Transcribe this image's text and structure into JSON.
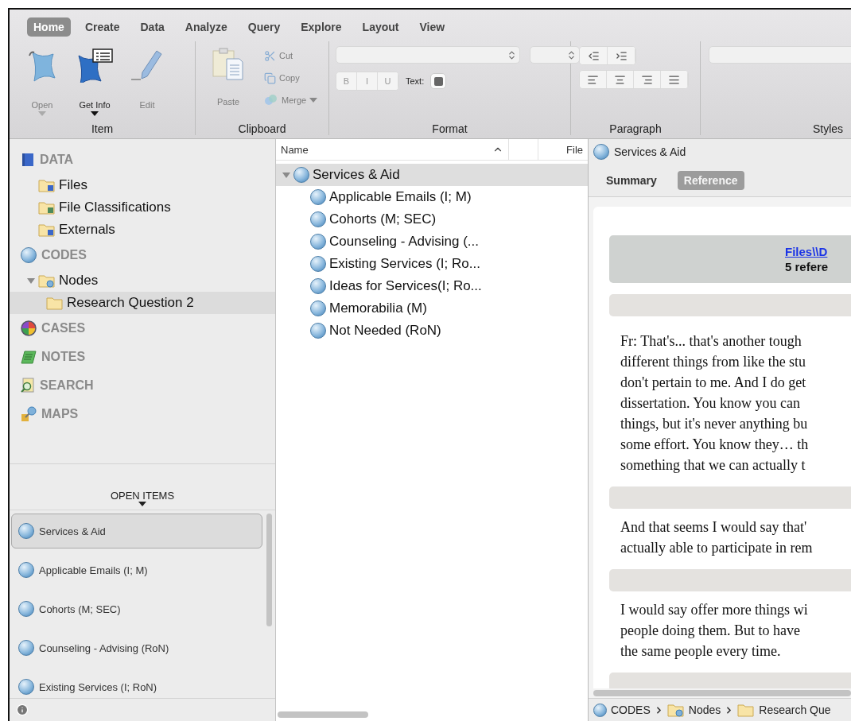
{
  "ribbon": {
    "tabs": [
      {
        "label": "Home",
        "selected": true
      },
      {
        "label": "Create",
        "selected": false
      },
      {
        "label": "Data",
        "selected": false
      },
      {
        "label": "Analyze",
        "selected": false
      },
      {
        "label": "Query",
        "selected": false
      },
      {
        "label": "Explore",
        "selected": false
      },
      {
        "label": "Layout",
        "selected": false
      },
      {
        "label": "View",
        "selected": false
      }
    ],
    "groups": [
      {
        "kind": "item",
        "label": "Item",
        "buttons": [
          {
            "kind": "open",
            "label": "Open",
            "disabled": true,
            "menu": true
          },
          {
            "kind": "info",
            "label": "Get Info",
            "disabled": false,
            "menu": true
          },
          {
            "kind": "edit",
            "label": "Edit",
            "disabled": true,
            "menu": false
          }
        ]
      },
      {
        "kind": "clipboard",
        "label": "Clipboard",
        "buttons": [
          {
            "kind": "paste",
            "label": "Paste",
            "disabled": true,
            "menu": false
          },
          {
            "kind": "cut",
            "label": "Cut",
            "disabled": true,
            "menu": false
          },
          {
            "kind": "copy",
            "label": "Copy",
            "disabled": true,
            "menu": false
          },
          {
            "kind": "merge",
            "label": "Merge",
            "disabled": true,
            "menu": true
          }
        ]
      },
      {
        "kind": "format",
        "label": "Format",
        "styles": [
          "B",
          "I",
          "U"
        ],
        "color_label": "Text:"
      },
      {
        "kind": "paragraph",
        "label": "Paragraph"
      },
      {
        "kind": "styles",
        "label": "Styles"
      }
    ]
  },
  "sidebar": {
    "sections": [
      {
        "kind": "data",
        "label": "DATA",
        "selected": false,
        "children": [
          {
            "kind": "files",
            "label": "Files",
            "selected": false
          },
          {
            "kind": "classifications",
            "label": "File Classifications",
            "selected": false
          },
          {
            "kind": "externals",
            "label": "Externals",
            "selected": false
          }
        ]
      },
      {
        "kind": "codes",
        "label": "CODES",
        "selected": false,
        "children": [
          {
            "kind": "nodes",
            "label": "Nodes",
            "selected": false,
            "expanded": true,
            "children": [
              {
                "kind": "folder",
                "label": "Research Question 2",
                "selected": true
              }
            ]
          }
        ]
      },
      {
        "kind": "cases",
        "label": "CASES",
        "selected": false
      },
      {
        "kind": "notes",
        "label": "NOTES",
        "selected": false
      },
      {
        "kind": "search",
        "label": "SEARCH",
        "selected": false
      },
      {
        "kind": "maps",
        "label": "MAPS",
        "selected": false
      }
    ]
  },
  "open_items": {
    "title": "OPEN ITEMS",
    "items": [
      {
        "label": "Services & Aid",
        "selected": true
      },
      {
        "label": "Applicable Emails (I; M)",
        "selected": false
      },
      {
        "label": "Cohorts (M; SEC)",
        "selected": false
      },
      {
        "label": "Counseling - Advising (RoN)",
        "selected": false
      },
      {
        "label": "Existing Services (I; RoN)",
        "selected": false
      }
    ]
  },
  "list": {
    "columns": [
      "Name",
      "File"
    ],
    "tree": [
      {
        "label": "Services & Aid",
        "selected": true,
        "expanded": true,
        "children": [
          {
            "label": "Applicable Emails (I; M)",
            "selected": false
          },
          {
            "label": "Cohorts (M; SEC)",
            "selected": false
          },
          {
            "label": "Counseling - Advising (...",
            "selected": false
          },
          {
            "label": "Existing Services (I; Ro...",
            "selected": false
          },
          {
            "label": "Ideas for Services(I; Ro...",
            "selected": false
          },
          {
            "label": "Memorabilia (M)",
            "selected": false
          },
          {
            "label": "Not Needed (RoN)",
            "selected": false
          }
        ]
      }
    ]
  },
  "detail": {
    "title": "Services & Aid",
    "tabs": [
      {
        "label": "Summary",
        "selected": false
      },
      {
        "label": "Reference",
        "selected": true
      }
    ],
    "document": {
      "link": "Files\\\\D",
      "count": "5 refere",
      "passages": [
        [
          "Fr: That's... that's another tough",
          "different things from like the stu",
          "don't pertain to me. And I do get",
          "dissertation. You know you can",
          "things, but it's never anything bu",
          "some effort. You know they… th",
          "something that we can actually t"
        ],
        [
          "And that seems I would say that'",
          "actually able to participate in rem"
        ],
        [
          "I would say offer more things wi",
          "people doing them. But to have",
          "the same people every time."
        ]
      ]
    },
    "breadcrumb": [
      {
        "kind": "codes",
        "label": "CODES"
      },
      {
        "kind": "nodes",
        "label": "Nodes"
      },
      {
        "kind": "folder",
        "label": "Research Que"
      }
    ]
  }
}
